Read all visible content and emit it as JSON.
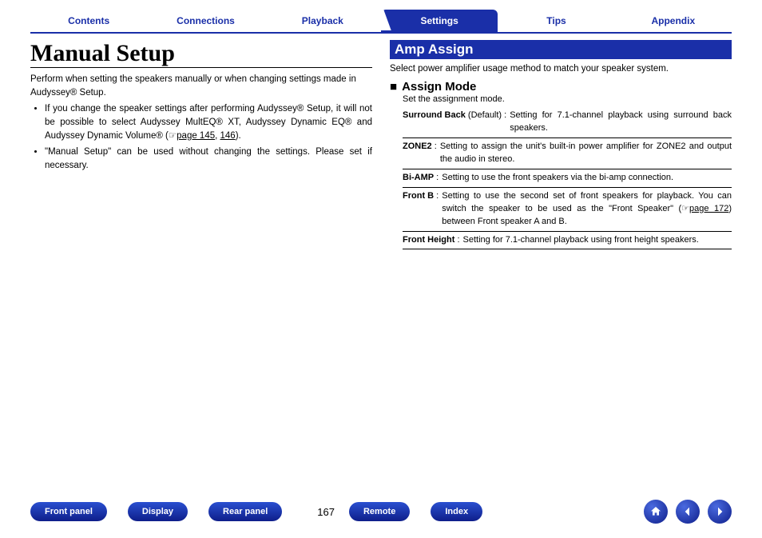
{
  "tabs": [
    "Contents",
    "Connections",
    "Playback",
    "Settings",
    "Tips",
    "Appendix"
  ],
  "activeTab": 3,
  "left": {
    "title": "Manual Setup",
    "intro": "Perform when setting the speakers manually or when changing settings made in Audyssey® Setup.",
    "bullet1a": "If you change the speaker settings after performing Audyssey® Setup, it will not be possible to select Audyssey MultEQ® XT, Audyssey Dynamic EQ® and Audyssey Dynamic Volume® (",
    "page145": "page 145",
    "comma": ", ",
    "page146": "146",
    "bullet1b": ").",
    "bullet2": "\"Manual Setup\" can be used without changing the settings. Please set if necessary."
  },
  "right": {
    "section": "Amp Assign",
    "sub": "Select power amplifier usage method to match your speaker system.",
    "h3": "Assign Mode",
    "note": "Set the assignment mode.",
    "modes": [
      {
        "term": "Surround Back",
        "def": " (Default) :",
        "desc": "Setting for 7.1-channel playback using surround back speakers."
      },
      {
        "term": "ZONE2",
        "def": " :",
        "desc": "Setting to assign the unit's built-in power amplifier for ZONE2 and output the audio in stereo."
      },
      {
        "term": "Bi-AMP",
        "def": " :",
        "desc": "Setting to use the front speakers via the bi-amp connection."
      },
      {
        "term": "Front B",
        "def": " :",
        "desc_a": "Setting to use the second set of front speakers for playback. You can switch the speaker to be used as the \"Front Speaker\" (",
        "page": "page 172",
        "desc_b": ") between Front speaker A and B."
      },
      {
        "term": "Front Height",
        "def": " :",
        "desc": "Setting for 7.1-channel playback using front height speakers."
      }
    ]
  },
  "footer": {
    "pills": [
      "Front panel",
      "Display",
      "Rear panel"
    ],
    "page": "167",
    "pills2": [
      "Remote",
      "Index"
    ]
  }
}
